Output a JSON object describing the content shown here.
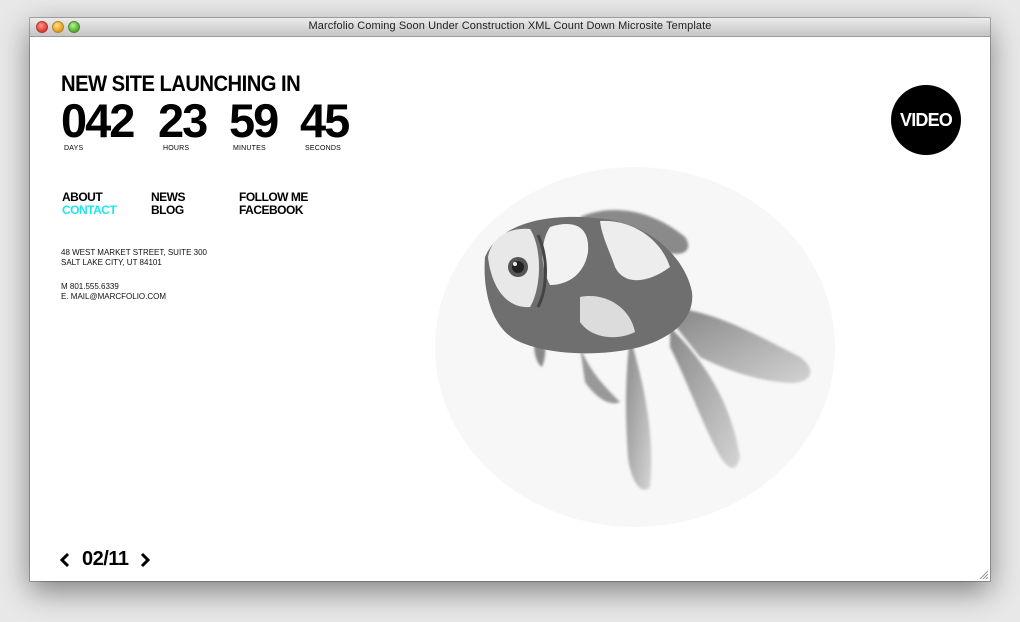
{
  "window": {
    "title": "Marcfolio Coming Soon Under Construction XML Count Down Microsite Template"
  },
  "headline": "NEW SITE LAUNCHING IN",
  "countdown": {
    "days": {
      "value": "042",
      "label": "DAYS"
    },
    "hours": {
      "value": "23",
      "label": "HOURS"
    },
    "minutes": {
      "value": "59",
      "label": "MINUTES"
    },
    "seconds": {
      "value": "45",
      "label": "SECONDS"
    }
  },
  "nav": {
    "about": "ABOUT",
    "contact": "CONTACT",
    "news": "NEWS",
    "blog": "BLOG",
    "follow": "FOLLOW ME",
    "facebook": "FACEBOOK"
  },
  "address": {
    "line1": "48 WEST MARKET STREET, SUITE 300",
    "line2": "SALT LAKE CITY, UT 84101"
  },
  "contact": {
    "phone": "M 801.555.6339",
    "email": "E. MAIL@MARCFOLIO.COM"
  },
  "video_button": "VIDEO",
  "pager": {
    "current": "02/11"
  },
  "colors": {
    "accent": "#1ee6ef",
    "text": "#000000",
    "background": "#ffffff"
  },
  "icons": {
    "prev": "chevron-left-icon",
    "next": "chevron-right-icon",
    "image": "goldfish-image"
  }
}
